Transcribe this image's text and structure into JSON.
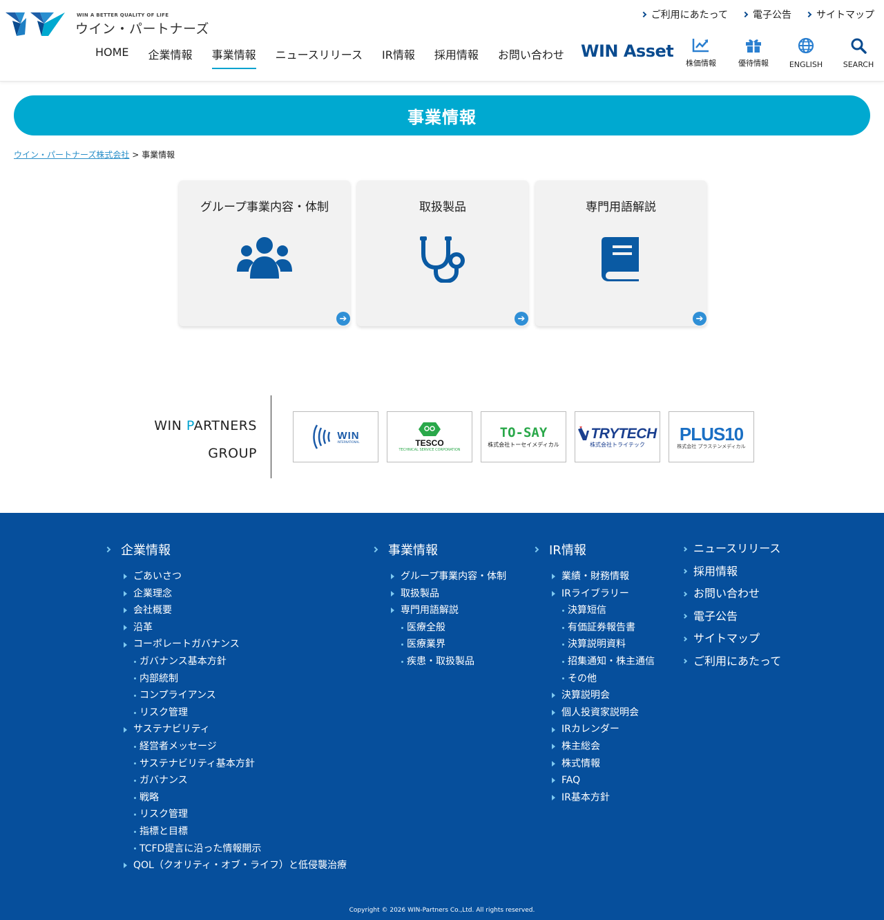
{
  "header": {
    "logo_tagline": "WIN A BETTER QUALITY OF LIFE",
    "logo_name": "ウイン・パートナーズ",
    "util_links": [
      "ご利用にあたって",
      "電子公告",
      "サイトマップ"
    ],
    "nav": [
      "HOME",
      "企業情報",
      "事業情報",
      "ニュースリリース",
      "IR情報",
      "採用情報",
      "お問い合わせ"
    ],
    "active_nav": "事業情報",
    "win_asset": "WIN Asset",
    "icon_links": {
      "stock": "株価情報",
      "benefit": "優待情報",
      "english": "ENGLISH",
      "search": "SEARCH"
    }
  },
  "banner": {
    "title": "事業情報"
  },
  "breadcrumb": {
    "home": "ウイン・パートナーズ株式会社",
    "separator": ">",
    "current": "事業情報"
  },
  "cards": [
    {
      "title": "グループ事業内容・体制",
      "icon": "users-icon"
    },
    {
      "title": "取扱製品",
      "icon": "stethoscope-icon"
    },
    {
      "title": "専門用語解説",
      "icon": "book-icon"
    }
  ],
  "group": {
    "title_line1_a": "WIN ",
    "title_line1_p": "P",
    "title_line1_b": "ARTNERS",
    "title_line2": "GROUP",
    "logos": {
      "win": {
        "text": "WIN",
        "sub": "INTERNATIONAL"
      },
      "tesco": {
        "text": "TESCO",
        "sub": "TECHNICAL SERVICE CORPORATION"
      },
      "tosay": {
        "text": "TO-SAY",
        "sub": "株式会社トーセイメディカル"
      },
      "trytech": {
        "text": "TRYTECH",
        "sub": "株式会社トライテック"
      },
      "plus10": {
        "text": "PLUS10",
        "sub": "株式会社 プラステンメディカル"
      }
    }
  },
  "footer": {
    "col1": {
      "head": "企業情報",
      "items": [
        {
          "label": "ごあいさつ",
          "level": 1
        },
        {
          "label": "企業理念",
          "level": 1
        },
        {
          "label": "会社概要",
          "level": 1
        },
        {
          "label": "沿革",
          "level": 1
        },
        {
          "label": "コーポレートガバナンス",
          "level": 1
        },
        {
          "label": "ガバナンス基本方針",
          "level": 2
        },
        {
          "label": "内部統制",
          "level": 2
        },
        {
          "label": "コンプライアンス",
          "level": 2
        },
        {
          "label": "リスク管理",
          "level": 2
        },
        {
          "label": "サステナビリティ",
          "level": 1
        },
        {
          "label": "経営者メッセージ",
          "level": 2
        },
        {
          "label": "サステナビリティ基本方針",
          "level": 2
        },
        {
          "label": "ガバナンス",
          "level": 2
        },
        {
          "label": "戦略",
          "level": 2
        },
        {
          "label": "リスク管理",
          "level": 2
        },
        {
          "label": "指標と目標",
          "level": 2
        },
        {
          "label": "TCFD提言に沿った情報開示",
          "level": 2
        },
        {
          "label": "QOL（クオリティ・オブ・ライフ）と低侵襲治療",
          "level": 1
        }
      ]
    },
    "col2": {
      "head": "事業情報",
      "items": [
        {
          "label": "グループ事業内容・体制",
          "level": 1
        },
        {
          "label": "取扱製品",
          "level": 1
        },
        {
          "label": "専門用語解説",
          "level": 1
        },
        {
          "label": "医療全般",
          "level": 2
        },
        {
          "label": "医療業界",
          "level": 2
        },
        {
          "label": "疾患・取扱製品",
          "level": 2
        }
      ]
    },
    "col3": {
      "head": "IR情報",
      "items": [
        {
          "label": "業績・財務情報",
          "level": 1
        },
        {
          "label": "IRライブラリー",
          "level": 1
        },
        {
          "label": "決算短信",
          "level": 2
        },
        {
          "label": "有価証券報告書",
          "level": 2
        },
        {
          "label": "決算説明資料",
          "level": 2
        },
        {
          "label": "招集通知・株主通信",
          "level": 2
        },
        {
          "label": "その他",
          "level": 2
        },
        {
          "label": "決算説明会",
          "level": 1
        },
        {
          "label": "個人投資家説明会",
          "level": 1
        },
        {
          "label": "IRカレンダー",
          "level": 1
        },
        {
          "label": "株主総会",
          "level": 1
        },
        {
          "label": "株式情報",
          "level": 1
        },
        {
          "label": "FAQ",
          "level": 1
        },
        {
          "label": "IR基本方針",
          "level": 1
        }
      ]
    },
    "col4": [
      "ニュースリリース",
      "採用情報",
      "お問い合わせ",
      "電子公告",
      "サイトマップ",
      "ご利用にあたって"
    ],
    "copyright": "Copyright © 2026 WIN-Partners Co.,Ltd. All rights reserved."
  },
  "colors": {
    "brand_blue": "#0a4b8f",
    "accent_cyan": "#00a9d0",
    "footer_bg": "#064f9c"
  }
}
